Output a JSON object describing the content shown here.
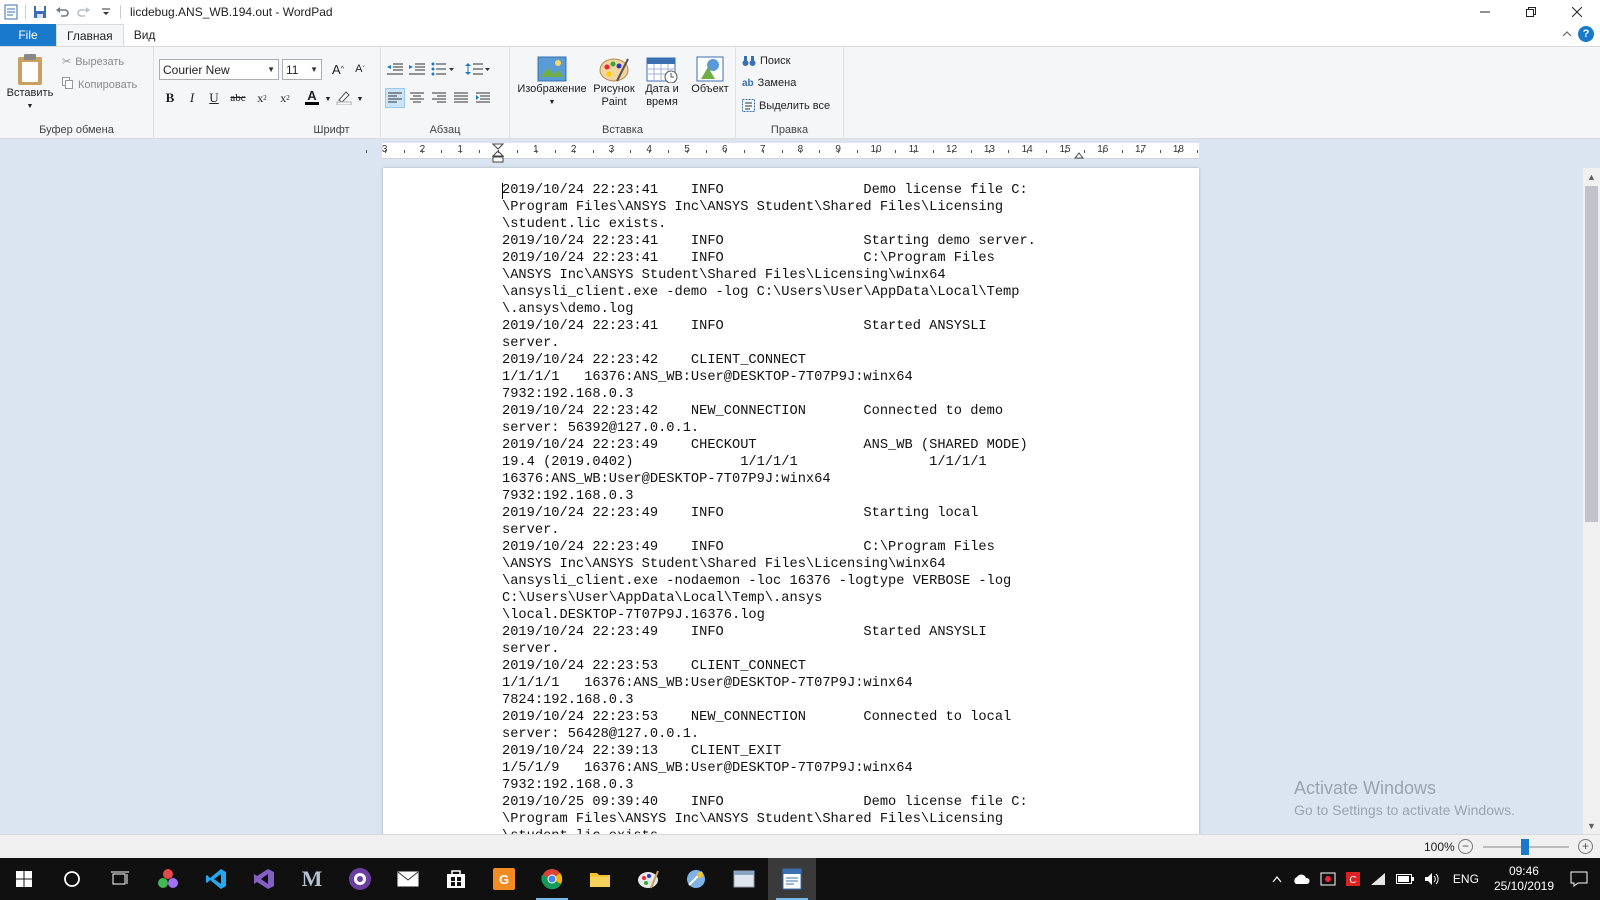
{
  "window": {
    "title": "licdebug.ANS_WB.194.out - WordPad",
    "minimize_icon": "minimize-icon",
    "maximize_icon": "restore-icon",
    "close_icon": "close-icon"
  },
  "quick_access": [
    "save-icon",
    "undo-icon",
    "redo-icon",
    "customize-dropdown-icon"
  ],
  "tabs": {
    "file": "File",
    "home": "Главная",
    "view": "Вид"
  },
  "ribbon": {
    "clipboard": {
      "label": "Буфер обмена",
      "paste": "Вставить",
      "cut": "Вырезать",
      "copy": "Копировать"
    },
    "font": {
      "label": "Шрифт",
      "family": "Courier New",
      "size": "11"
    },
    "paragraph": {
      "label": "Абзац"
    },
    "insert": {
      "label": "Вставка",
      "picture": "Изображение",
      "paint_line1": "Рисунок",
      "paint_line2": "Paint",
      "datetime_line1": "Дата и",
      "datetime_line2": "время",
      "object": "Объект"
    },
    "editing": {
      "label": "Правка",
      "find": "Поиск",
      "replace": "Замена",
      "select_all": "Выделить все"
    }
  },
  "ruler": {
    "labels": [
      "3",
      "2",
      "1",
      "1",
      "2",
      "3",
      "4",
      "5",
      "6",
      "7",
      "8",
      "9",
      "10",
      "11",
      "12",
      "13",
      "14",
      "15",
      "16",
      "17",
      "18"
    ]
  },
  "document": {
    "text": "2019/10/24 22:23:41    INFO                 Demo license file C:\n\\Program Files\\ANSYS Inc\\ANSYS Student\\Shared Files\\Licensing\n\\student.lic exists.\n2019/10/24 22:23:41    INFO                 Starting demo server.\n2019/10/24 22:23:41    INFO                 C:\\Program Files\n\\ANSYS Inc\\ANSYS Student\\Shared Files\\Licensing\\winx64\n\\ansysli_client.exe -demo -log C:\\Users\\User\\AppData\\Local\\Temp\n\\.ansys\\demo.log\n2019/10/24 22:23:41    INFO                 Started ANSYSLI\nserver.\n2019/10/24 22:23:42    CLIENT_CONNECT\n1/1/1/1   16376:ANS_WB:User@DESKTOP-7T07P9J:winx64\n7932:192.168.0.3\n2019/10/24 22:23:42    NEW_CONNECTION       Connected to demo\nserver: 56392@127.0.0.1.\n2019/10/24 22:23:49    CHECKOUT             ANS_WB (SHARED MODE)\n19.4 (2019.0402)             1/1/1/1                1/1/1/1\n16376:ANS_WB:User@DESKTOP-7T07P9J:winx64\n7932:192.168.0.3\n2019/10/24 22:23:49    INFO                 Starting local\nserver.\n2019/10/24 22:23:49    INFO                 C:\\Program Files\n\\ANSYS Inc\\ANSYS Student\\Shared Files\\Licensing\\winx64\n\\ansysli_client.exe -nodaemon -loc 16376 -logtype VERBOSE -log\nC:\\Users\\User\\AppData\\Local\\Temp\\.ansys\n\\local.DESKTOP-7T07P9J.16376.log\n2019/10/24 22:23:49    INFO                 Started ANSYSLI\nserver.\n2019/10/24 22:23:53    CLIENT_CONNECT\n1/1/1/1   16376:ANS_WB:User@DESKTOP-7T07P9J:winx64\n7824:192.168.0.3\n2019/10/24 22:23:53    NEW_CONNECTION       Connected to local\nserver: 56428@127.0.0.1.\n2019/10/24 22:39:13    CLIENT_EXIT\n1/5/1/9   16376:ANS_WB:User@DESKTOP-7T07P9J:winx64\n7932:192.168.0.3\n2019/10/25 09:39:40    INFO                 Demo license file C:\n\\Program Files\\ANSYS Inc\\ANSYS Student\\Shared Files\\Licensing\n\\student.lic exists."
  },
  "watermark": {
    "line1": "Activate Windows",
    "line2": "Go to Settings to activate Windows."
  },
  "status": {
    "zoom": "100%"
  },
  "taskbar": {
    "apps": [
      "start-icon",
      "cortana-icon",
      "task-view-icon",
      "app-colorful-icon",
      "vscode-icon",
      "visual-studio-icon",
      "m-app-icon",
      "purple-app-icon",
      "mail-icon",
      "store-icon",
      "orange-app-icon",
      "chrome-icon",
      "file-explorer-icon",
      "paint-icon",
      "app-tools-icon",
      "app-window-icon",
      "wordpad-icon"
    ],
    "language": "ENG",
    "time": "09:46",
    "date": "25/10/2019"
  },
  "colors": {
    "accent": "#1979ca",
    "workspace": "#dbe5f1",
    "taskbar": "#101010"
  }
}
